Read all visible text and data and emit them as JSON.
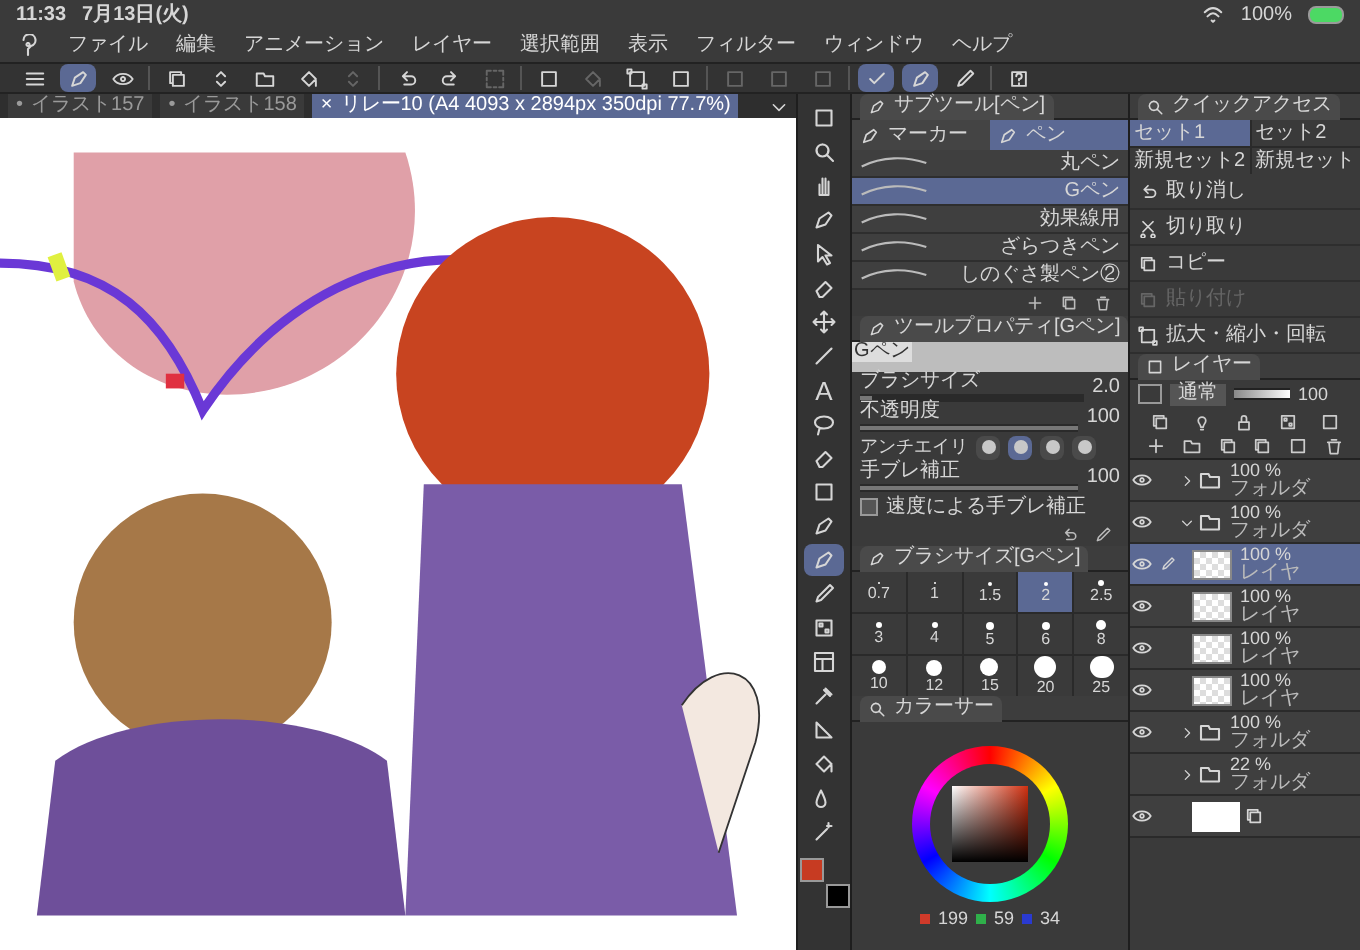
{
  "status_bar": {
    "time": "11:33",
    "date": "7月13日(火)",
    "battery": "100%"
  },
  "menu": [
    "ファイル",
    "編集",
    "アニメーション",
    "レイヤー",
    "選択範囲",
    "表示",
    "フィルター",
    "ウィンドウ",
    "ヘルプ"
  ],
  "toolbar": [
    {
      "selected": false,
      "disabled": false
    },
    {
      "selected": true,
      "disabled": false
    },
    {
      "selected": false,
      "disabled": false
    },
    {
      "selected": false,
      "disabled": false
    },
    {
      "selected": false,
      "disabled": false
    },
    {
      "selected": false,
      "disabled": false
    },
    {
      "selected": false,
      "disabled": false
    },
    {
      "selected": false,
      "disabled": true
    },
    {
      "selected": false,
      "disabled": false
    },
    {
      "selected": false,
      "disabled": false
    },
    {
      "selected": false,
      "disabled": true
    },
    {
      "selected": false,
      "disabled": false
    },
    {
      "selected": false,
      "disabled": true
    },
    {
      "selected": false,
      "disabled": false
    },
    {
      "selected": false,
      "disabled": false
    },
    {
      "selected": false,
      "disabled": true
    },
    {
      "selected": false,
      "disabled": true
    },
    {
      "selected": false,
      "disabled": true
    },
    {
      "selected": true,
      "disabled": false
    },
    {
      "selected": true,
      "disabled": false
    },
    {
      "selected": false,
      "disabled": false
    },
    {
      "selected": false,
      "disabled": false
    }
  ],
  "canvas_tabs": [
    {
      "marker": "•",
      "label": "イラスト157",
      "selected": false
    },
    {
      "marker": "•",
      "label": "イラスト158",
      "selected": false
    },
    {
      "marker": "×",
      "label": "リレー10 (A4 4093 x 2894px 350dpi 77.7%)",
      "selected": true
    }
  ],
  "tools": [
    {
      "selected": false
    },
    {
      "selected": false
    },
    {
      "selected": false
    },
    {
      "selected": false
    },
    {
      "selected": false
    },
    {
      "selected": false
    },
    {
      "selected": false
    },
    {
      "selected": false
    },
    {
      "selected": false,
      "glyph": "A"
    },
    {
      "selected": false
    },
    {
      "selected": false
    },
    {
      "selected": false
    },
    {
      "selected": false
    },
    {
      "selected": true
    },
    {
      "selected": false
    },
    {
      "selected": false
    },
    {
      "selected": false
    },
    {
      "selected": false
    },
    {
      "selected": false
    },
    {
      "selected": false
    },
    {
      "selected": false
    },
    {
      "selected": false
    }
  ],
  "colors": [
    {
      "color": "#c73b22"
    },
    {
      "color": "#000000"
    }
  ],
  "sub_tool": {
    "title": "サブツール[ペン]",
    "tabs": [
      {
        "label": "マーカー",
        "selected": false
      },
      {
        "label": "ペン",
        "selected": true
      }
    ],
    "brushes": [
      {
        "label": "丸ペン",
        "selected": false
      },
      {
        "label": "Gペン",
        "selected": true
      },
      {
        "label": "効果線用",
        "selected": false
      },
      {
        "label": "ざらつきペン",
        "selected": false
      },
      {
        "label": "しのぐさ製ペン②",
        "selected": false
      }
    ]
  },
  "tool_property": {
    "title": "ツールプロパティ[Gペン]",
    "preview_label": "Gペン",
    "rows": [
      {
        "kind": "slider",
        "label": "ブラシサイズ",
        "value": "2.0",
        "level": 0.05
      },
      {
        "kind": "slider",
        "label": "不透明度",
        "value": "100",
        "level": 1
      },
      {
        "kind": "antialias",
        "label": "アンチエイリ",
        "options": [
          {
            "selected": false
          },
          {
            "selected": true
          },
          {
            "selected": false
          },
          {
            "selected": false
          }
        ]
      },
      {
        "kind": "slider",
        "label": "手ブレ補正",
        "value": "100",
        "level": 1
      },
      {
        "kind": "checkbox",
        "label": "速度による手ブレ補正",
        "checked": false
      }
    ]
  },
  "brush_size": {
    "title": "ブラシサイズ[Gペン]",
    "sizes": [
      {
        "label": "0.7",
        "selected": false
      },
      {
        "label": "1",
        "selected": false
      },
      {
        "label": "1.5",
        "selected": false
      },
      {
        "label": "2",
        "selected": true
      },
      {
        "label": "2.5",
        "selected": false
      },
      {
        "label": "3",
        "selected": false
      },
      {
        "label": "4",
        "selected": false
      },
      {
        "label": "5",
        "selected": false
      },
      {
        "label": "6",
        "selected": false
      },
      {
        "label": "8",
        "selected": false
      },
      {
        "label": "10",
        "selected": false
      },
      {
        "label": "12",
        "selected": false
      },
      {
        "label": "15",
        "selected": false
      },
      {
        "label": "20",
        "selected": false
      },
      {
        "label": "25",
        "selected": false
      }
    ]
  },
  "color_panel": {
    "title": "カラーサー",
    "rgb": [
      {
        "value": "199",
        "color": "#d03a2a"
      },
      {
        "value": "59",
        "color": "#2fb04a"
      },
      {
        "value": "34",
        "color": "#2a3ad0"
      }
    ]
  },
  "quick_access": {
    "title": "クイックアクセス",
    "sets": [
      {
        "label": "セット1",
        "selected": true
      },
      {
        "label": "セット2",
        "selected": false
      },
      {
        "label": "新規セット2",
        "selected": false
      },
      {
        "label": "新規セット",
        "selected": false
      }
    ],
    "items": [
      {
        "label": "取り消し",
        "disabled": false
      },
      {
        "label": "切り取り",
        "disabled": false
      },
      {
        "label": "コピー",
        "disabled": false
      },
      {
        "label": "貼り付け",
        "disabled": true
      },
      {
        "label": "拡大・縮小・回転",
        "disabled": false
      }
    ]
  },
  "layers": {
    "title": "レイヤー",
    "blend_mode": "通常",
    "level": 1,
    "opacity": "100",
    "items": [
      {
        "kind": "folder",
        "opacity": "100 %",
        "label": "フォルダ",
        "expanded": false,
        "visible": true,
        "selected": false
      },
      {
        "kind": "folder",
        "opacity": "100 %",
        "label": "フォルダ",
        "expanded": true,
        "visible": true,
        "selected": false,
        "children": [
          {
            "kind": "raster",
            "opacity": "100 %",
            "label": "レイヤ",
            "visible": true,
            "selected": true
          },
          {
            "kind": "raster",
            "opacity": "100 %",
            "label": "レイヤ",
            "visible": true,
            "selected": false
          },
          {
            "kind": "raster",
            "opacity": "100 %",
            "label": "レイヤ",
            "visible": true,
            "selected": false
          },
          {
            "kind": "raster",
            "opacity": "100 %",
            "label": "レイヤ",
            "visible": true,
            "selected": false
          }
        ]
      },
      {
        "kind": "folder",
        "opacity": "100 %",
        "label": "フォルダ",
        "expanded": false,
        "visible": true,
        "selected": false
      },
      {
        "kind": "folder",
        "opacity": "22 %",
        "label": "フォルダ",
        "expanded": false,
        "visible": false,
        "selected": false
      },
      {
        "kind": "paper",
        "visible": true,
        "selected": false
      }
    ]
  }
}
